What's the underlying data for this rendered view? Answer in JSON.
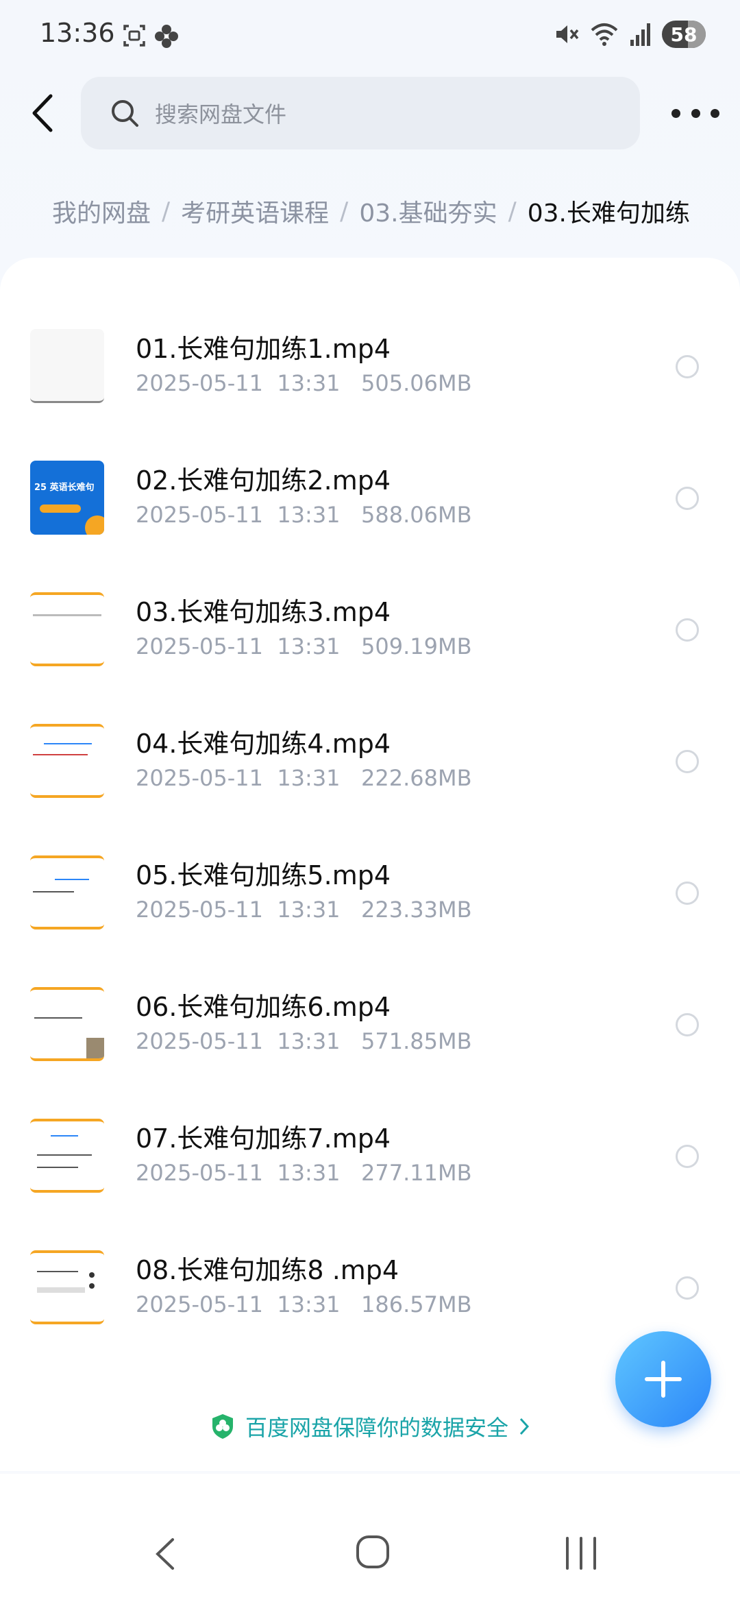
{
  "status_bar": {
    "time": "13:36",
    "battery": "58",
    "icons": [
      "screenshot-icon",
      "pinwheel-icon",
      "mute-icon",
      "wifi-icon",
      "signal-icon"
    ]
  },
  "header": {
    "search_placeholder": "搜索网盘文件"
  },
  "breadcrumb": {
    "items": [
      "我的网盘",
      "考研英语课程",
      "03.基础夯实",
      "03.长难句加练"
    ],
    "separator": "/"
  },
  "files": [
    {
      "name": "01.长难句加练1.mp4",
      "date": "2025-05-11",
      "time": "13:31",
      "size": "505.06MB"
    },
    {
      "name": "02.长难句加练2.mp4",
      "date": "2025-05-11",
      "time": "13:31",
      "size": "588.06MB"
    },
    {
      "name": "03.长难句加练3.mp4",
      "date": "2025-05-11",
      "time": "13:31",
      "size": "509.19MB"
    },
    {
      "name": "04.长难句加练4.mp4",
      "date": "2025-05-11",
      "time": "13:31",
      "size": "222.68MB"
    },
    {
      "name": "05.长难句加练5.mp4",
      "date": "2025-05-11",
      "time": "13:31",
      "size": "223.33MB"
    },
    {
      "name": "06.长难句加练6.mp4",
      "date": "2025-05-11",
      "time": "13:31",
      "size": "571.85MB"
    },
    {
      "name": "07.长难句加练7.mp4",
      "date": "2025-05-11",
      "time": "13:31",
      "size": "277.11MB"
    },
    {
      "name": "08.长难句加练8 .mp4",
      "date": "2025-05-11",
      "time": "13:31",
      "size": "186.57MB"
    }
  ],
  "thumb2_text": "25 英语长难句",
  "footer": {
    "security_text": "百度网盘保障你的数据安全"
  },
  "colors": {
    "accent": "#2b86f8",
    "security_green": "#1aa4a8",
    "thumb_orange": "#f5a623"
  }
}
